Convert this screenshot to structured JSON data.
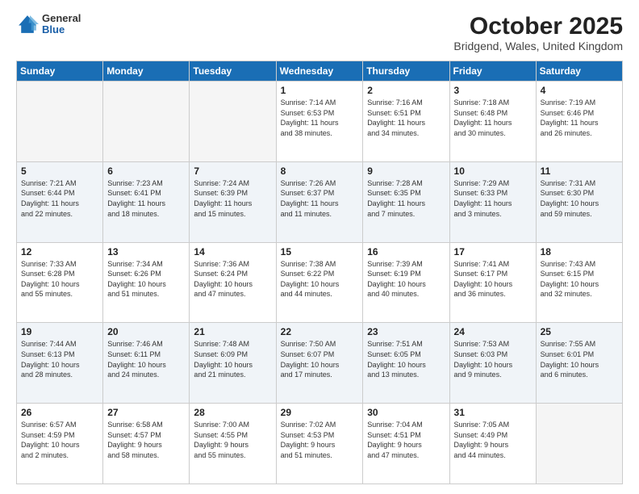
{
  "header": {
    "logo_general": "General",
    "logo_blue": "Blue",
    "main_title": "October 2025",
    "subtitle": "Bridgend, Wales, United Kingdom"
  },
  "days_of_week": [
    "Sunday",
    "Monday",
    "Tuesday",
    "Wednesday",
    "Thursday",
    "Friday",
    "Saturday"
  ],
  "weeks": [
    [
      {
        "day": "",
        "info": ""
      },
      {
        "day": "",
        "info": ""
      },
      {
        "day": "",
        "info": ""
      },
      {
        "day": "1",
        "info": "Sunrise: 7:14 AM\nSunset: 6:53 PM\nDaylight: 11 hours\nand 38 minutes."
      },
      {
        "day": "2",
        "info": "Sunrise: 7:16 AM\nSunset: 6:51 PM\nDaylight: 11 hours\nand 34 minutes."
      },
      {
        "day": "3",
        "info": "Sunrise: 7:18 AM\nSunset: 6:48 PM\nDaylight: 11 hours\nand 30 minutes."
      },
      {
        "day": "4",
        "info": "Sunrise: 7:19 AM\nSunset: 6:46 PM\nDaylight: 11 hours\nand 26 minutes."
      }
    ],
    [
      {
        "day": "5",
        "info": "Sunrise: 7:21 AM\nSunset: 6:44 PM\nDaylight: 11 hours\nand 22 minutes."
      },
      {
        "day": "6",
        "info": "Sunrise: 7:23 AM\nSunset: 6:41 PM\nDaylight: 11 hours\nand 18 minutes."
      },
      {
        "day": "7",
        "info": "Sunrise: 7:24 AM\nSunset: 6:39 PM\nDaylight: 11 hours\nand 15 minutes."
      },
      {
        "day": "8",
        "info": "Sunrise: 7:26 AM\nSunset: 6:37 PM\nDaylight: 11 hours\nand 11 minutes."
      },
      {
        "day": "9",
        "info": "Sunrise: 7:28 AM\nSunset: 6:35 PM\nDaylight: 11 hours\nand 7 minutes."
      },
      {
        "day": "10",
        "info": "Sunrise: 7:29 AM\nSunset: 6:33 PM\nDaylight: 11 hours\nand 3 minutes."
      },
      {
        "day": "11",
        "info": "Sunrise: 7:31 AM\nSunset: 6:30 PM\nDaylight: 10 hours\nand 59 minutes."
      }
    ],
    [
      {
        "day": "12",
        "info": "Sunrise: 7:33 AM\nSunset: 6:28 PM\nDaylight: 10 hours\nand 55 minutes."
      },
      {
        "day": "13",
        "info": "Sunrise: 7:34 AM\nSunset: 6:26 PM\nDaylight: 10 hours\nand 51 minutes."
      },
      {
        "day": "14",
        "info": "Sunrise: 7:36 AM\nSunset: 6:24 PM\nDaylight: 10 hours\nand 47 minutes."
      },
      {
        "day": "15",
        "info": "Sunrise: 7:38 AM\nSunset: 6:22 PM\nDaylight: 10 hours\nand 44 minutes."
      },
      {
        "day": "16",
        "info": "Sunrise: 7:39 AM\nSunset: 6:19 PM\nDaylight: 10 hours\nand 40 minutes."
      },
      {
        "day": "17",
        "info": "Sunrise: 7:41 AM\nSunset: 6:17 PM\nDaylight: 10 hours\nand 36 minutes."
      },
      {
        "day": "18",
        "info": "Sunrise: 7:43 AM\nSunset: 6:15 PM\nDaylight: 10 hours\nand 32 minutes."
      }
    ],
    [
      {
        "day": "19",
        "info": "Sunrise: 7:44 AM\nSunset: 6:13 PM\nDaylight: 10 hours\nand 28 minutes."
      },
      {
        "day": "20",
        "info": "Sunrise: 7:46 AM\nSunset: 6:11 PM\nDaylight: 10 hours\nand 24 minutes."
      },
      {
        "day": "21",
        "info": "Sunrise: 7:48 AM\nSunset: 6:09 PM\nDaylight: 10 hours\nand 21 minutes."
      },
      {
        "day": "22",
        "info": "Sunrise: 7:50 AM\nSunset: 6:07 PM\nDaylight: 10 hours\nand 17 minutes."
      },
      {
        "day": "23",
        "info": "Sunrise: 7:51 AM\nSunset: 6:05 PM\nDaylight: 10 hours\nand 13 minutes."
      },
      {
        "day": "24",
        "info": "Sunrise: 7:53 AM\nSunset: 6:03 PM\nDaylight: 10 hours\nand 9 minutes."
      },
      {
        "day": "25",
        "info": "Sunrise: 7:55 AM\nSunset: 6:01 PM\nDaylight: 10 hours\nand 6 minutes."
      }
    ],
    [
      {
        "day": "26",
        "info": "Sunrise: 6:57 AM\nSunset: 4:59 PM\nDaylight: 10 hours\nand 2 minutes."
      },
      {
        "day": "27",
        "info": "Sunrise: 6:58 AM\nSunset: 4:57 PM\nDaylight: 9 hours\nand 58 minutes."
      },
      {
        "day": "28",
        "info": "Sunrise: 7:00 AM\nSunset: 4:55 PM\nDaylight: 9 hours\nand 55 minutes."
      },
      {
        "day": "29",
        "info": "Sunrise: 7:02 AM\nSunset: 4:53 PM\nDaylight: 9 hours\nand 51 minutes."
      },
      {
        "day": "30",
        "info": "Sunrise: 7:04 AM\nSunset: 4:51 PM\nDaylight: 9 hours\nand 47 minutes."
      },
      {
        "day": "31",
        "info": "Sunrise: 7:05 AM\nSunset: 4:49 PM\nDaylight: 9 hours\nand 44 minutes."
      },
      {
        "day": "",
        "info": ""
      }
    ]
  ]
}
